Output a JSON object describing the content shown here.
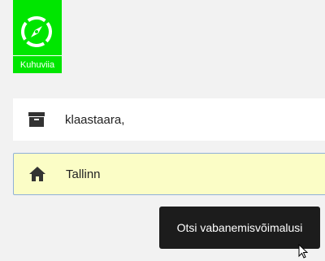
{
  "brand": {
    "logo_text": "Kuhuviia",
    "logo_color": "#00e600"
  },
  "form": {
    "destination": {
      "value": "klaastaara,",
      "icon": "archive-box-icon"
    },
    "home": {
      "value": "Tallinn",
      "icon": "home-icon",
      "background": "#fbfdc6"
    },
    "search_button_label": "Otsi vabanemisvõimalusi"
  },
  "cursor": {
    "icon": "mouse-pointer-icon"
  }
}
